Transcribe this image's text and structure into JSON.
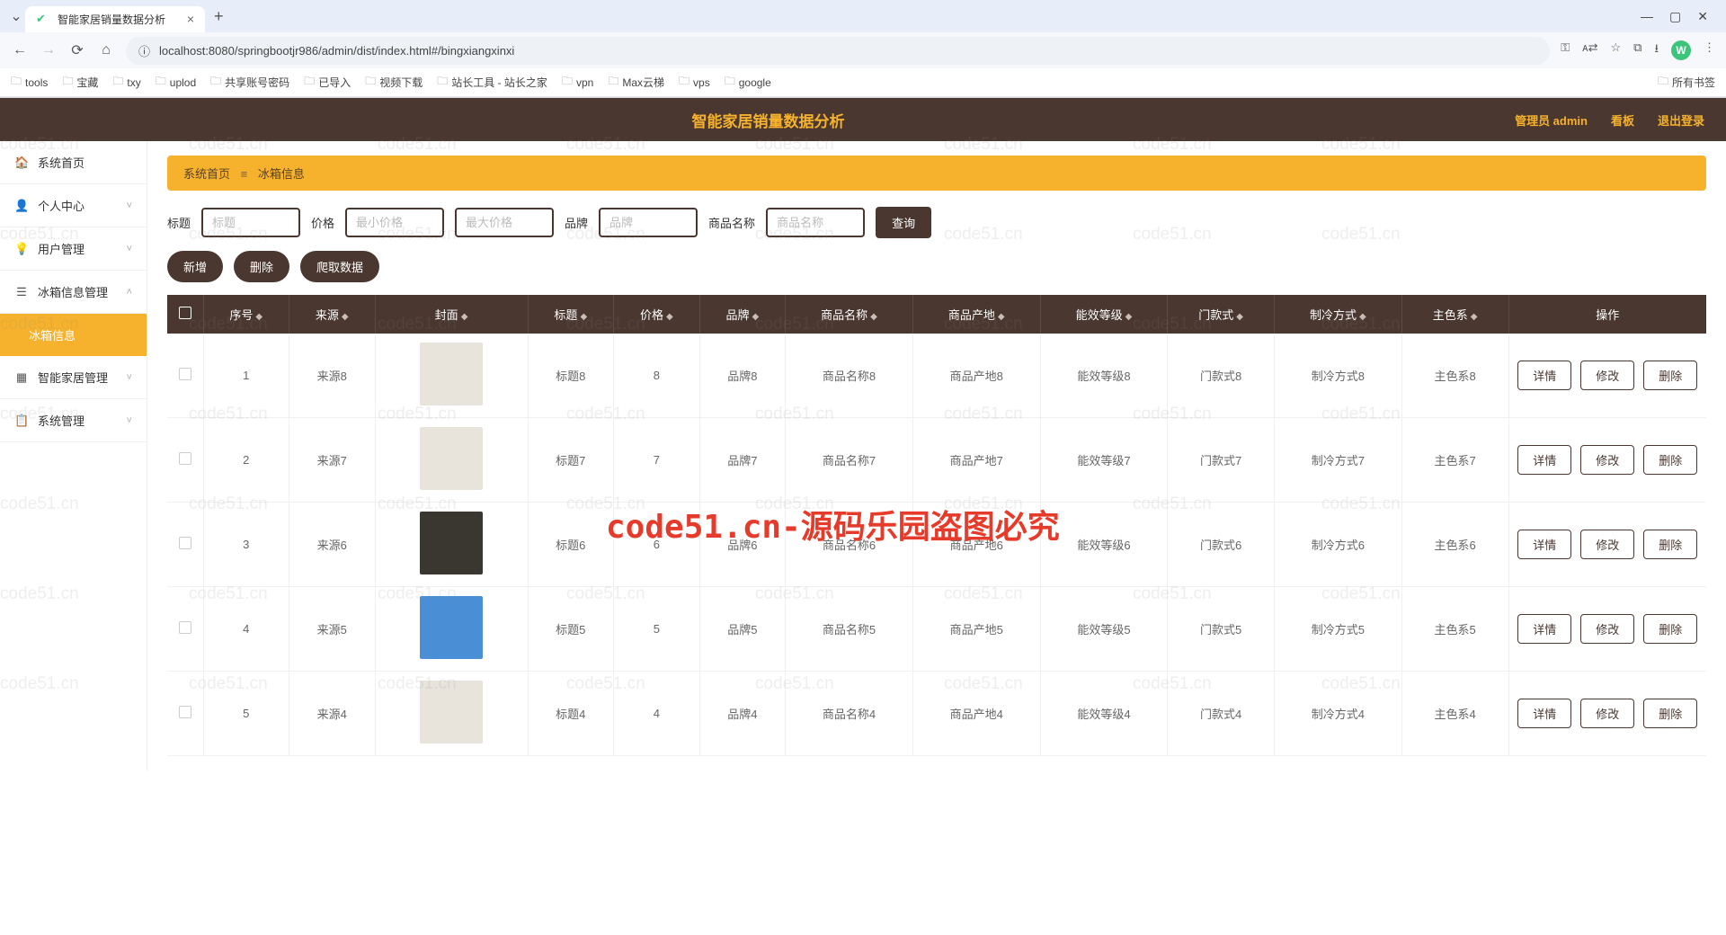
{
  "browser": {
    "tab_title": "智能家居销量数据分析",
    "url": "localhost:8080/springbootjr986/admin/dist/index.html#/bingxiangxinxi",
    "avatar_letter": "W",
    "bookmarks": [
      "tools",
      "宝藏",
      "txy",
      "uplod",
      "共享账号密码",
      "已导入",
      "视频下载",
      "站长工具 - 站长之家",
      "vpn",
      "Max云梯",
      "vps",
      "google"
    ],
    "bookmarks_right": "所有书签"
  },
  "header": {
    "title": "智能家居销量数据分析",
    "user": "管理员 admin",
    "dashboard": "看板",
    "logout": "退出登录"
  },
  "sidebar": {
    "items": [
      {
        "label": "系统首页",
        "icon": "🏠",
        "expand": false
      },
      {
        "label": "个人中心",
        "icon": "👤",
        "expand": true
      },
      {
        "label": "用户管理",
        "icon": "💡",
        "expand": true
      },
      {
        "label": "冰箱信息管理",
        "icon": "☰",
        "expand": true,
        "open": true
      },
      {
        "label": "冰箱信息",
        "sub": true,
        "active": true
      },
      {
        "label": "智能家居管理",
        "icon": "▦",
        "expand": true
      },
      {
        "label": "系统管理",
        "icon": "📋",
        "expand": true
      }
    ]
  },
  "breadcrumb": {
    "home": "系统首页",
    "current": "冰箱信息"
  },
  "filters": {
    "l_title": "标题",
    "ph_title": "标题",
    "l_price": "价格",
    "ph_min": "最小价格",
    "ph_max": "最大价格",
    "l_brand": "品牌",
    "ph_brand": "品牌",
    "l_name": "商品名称",
    "ph_name": "商品名称",
    "search": "查询"
  },
  "actions": {
    "add": "新增",
    "del": "删除",
    "crawl": "爬取数据"
  },
  "table": {
    "headers": [
      "序号",
      "来源",
      "封面",
      "标题",
      "价格",
      "品牌",
      "商品名称",
      "商品产地",
      "能效等级",
      "门款式",
      "制冷方式",
      "主色系",
      "操作"
    ],
    "row_buttons": {
      "detail": "详情",
      "edit": "修改",
      "delete": "删除"
    },
    "rows": [
      {
        "idx": "1",
        "src": "来源8",
        "thumb": "beige",
        "title": "标题8",
        "price": "8",
        "brand": "品牌8",
        "name": "商品名称8",
        "origin": "商品产地8",
        "energy": "能效等级8",
        "door": "门款式8",
        "cooling": "制冷方式8",
        "color": "主色系8"
      },
      {
        "idx": "2",
        "src": "来源7",
        "thumb": "beige",
        "title": "标题7",
        "price": "7",
        "brand": "品牌7",
        "name": "商品名称7",
        "origin": "商品产地7",
        "energy": "能效等级7",
        "door": "门款式7",
        "cooling": "制冷方式7",
        "color": "主色系7"
      },
      {
        "idx": "3",
        "src": "来源6",
        "thumb": "dark",
        "title": "标题6",
        "price": "6",
        "brand": "品牌6",
        "name": "商品名称6",
        "origin": "商品产地6",
        "energy": "能效等级6",
        "door": "门款式6",
        "cooling": "制冷方式6",
        "color": "主色系6"
      },
      {
        "idx": "4",
        "src": "来源5",
        "thumb": "blue",
        "title": "标题5",
        "price": "5",
        "brand": "品牌5",
        "name": "商品名称5",
        "origin": "商品产地5",
        "energy": "能效等级5",
        "door": "门款式5",
        "cooling": "制冷方式5",
        "color": "主色系5"
      },
      {
        "idx": "5",
        "src": "来源4",
        "thumb": "beige",
        "title": "标题4",
        "price": "4",
        "brand": "品牌4",
        "name": "商品名称4",
        "origin": "商品产地4",
        "energy": "能效等级4",
        "door": "门款式4",
        "cooling": "制冷方式4",
        "color": "主色系4"
      }
    ]
  },
  "watermark": "code51.cn-源码乐园盗图必究",
  "wm_repeat": "code51.cn"
}
